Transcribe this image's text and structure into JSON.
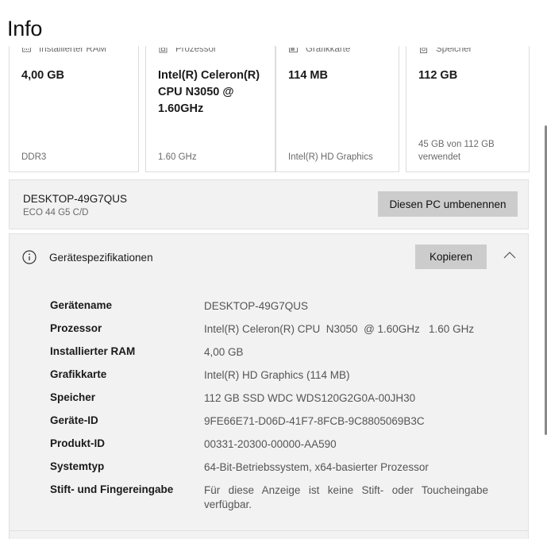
{
  "page": {
    "title": "Info"
  },
  "cards": [
    {
      "label": "Installierter RAM",
      "icon": "ram-icon",
      "value": "4,00 GB",
      "footer": "DDR3"
    },
    {
      "label": "Prozessor",
      "icon": "cpu-icon",
      "value": "Intel(R) Celeron(R) CPU  N3050  @ 1.60GHz",
      "footer": "1.60 GHz"
    },
    {
      "label": "Grafikkarte",
      "icon": "gpu-icon",
      "value": "114 MB",
      "footer": "Intel(R) HD Graphics"
    },
    {
      "label": "Speicher",
      "icon": "storage-icon",
      "value": "112 GB",
      "footer": "45 GB von 112 GB verwendet"
    }
  ],
  "device": {
    "name": "DESKTOP-49G7QUS",
    "model": "ECO 44 G5 C/D",
    "rename_label": "Diesen PC umbenennen"
  },
  "specs": {
    "title": "Gerätespezifikationen",
    "copy_label": "Kopieren",
    "rows": [
      {
        "label": "Gerätename",
        "value": "DESKTOP-49G7QUS"
      },
      {
        "label": "Prozessor",
        "value": "Intel(R) Celeron(R) CPU  N3050  @ 1.60GHz   1.60 GHz"
      },
      {
        "label": "Installierter RAM",
        "value": "4,00 GB"
      },
      {
        "label": "Grafikkarte",
        "value": "Intel(R) HD Graphics (114 MB)"
      },
      {
        "label": "Speicher",
        "value": "112 GB SSD WDC WDS120G2G0A-00JH30"
      },
      {
        "label": "Geräte-ID",
        "value": "9FE66E71-D06D-41F7-8FCB-9C8805069B3C"
      },
      {
        "label": "Produkt-ID",
        "value": "00331-20300-00000-AA590"
      },
      {
        "label": "Systemtyp",
        "value": "64-Bit-Betriebssystem, x64-basierter Prozessor"
      },
      {
        "label": "Stift- und Fingereingabe",
        "value": "Für diese Anzeige ist keine Stift- oder Toucheingabe verfügbar."
      }
    ]
  }
}
